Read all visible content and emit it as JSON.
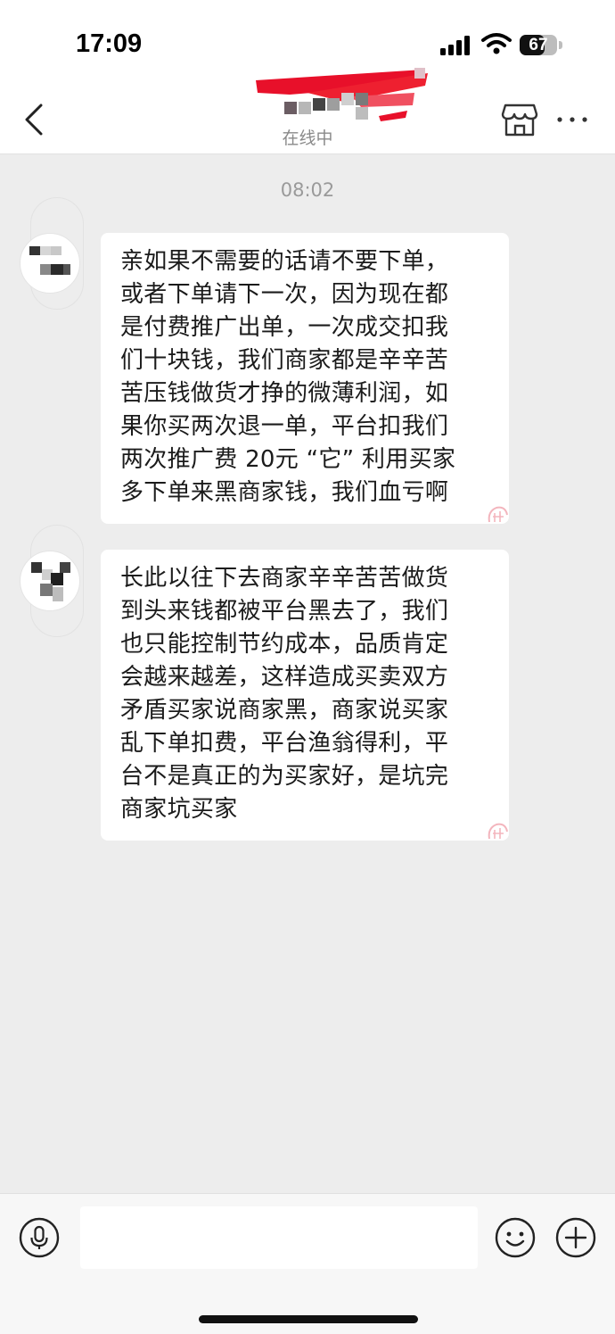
{
  "status_bar": {
    "time": "17:09",
    "battery_label": "67",
    "battery_level": 0.67
  },
  "nav": {
    "back_icon": "chevron-left-icon",
    "subtitle": "在线中",
    "shop_icon": "shop-icon",
    "more_icon": "more-dots-icon"
  },
  "chat": {
    "timestamp": "08:02",
    "messages": [
      {
        "lines": [
          "亲如果不需要的话请不要下单，",
          "或者下单请下一次，因为现在都",
          "是付费推广出单，一次成交扣我",
          "们十块钱，我们商家都是辛辛苦",
          "苦压钱做货才挣的微薄利润，如",
          "果你买两次退一单，平台扣我们",
          "两次推广费 20元 “它” 利用买家",
          "多下单来黑商家钱，我们血亏啊"
        ]
      },
      {
        "lines": [
          "长此以往下去商家辛辛苦苦做货",
          "到头来钱都被平台黑去了，我们",
          "也只能控制节约成本，品质肯定",
          "会越来越差，这样造成买卖双方",
          "矛盾买家说商家黑，商家说买家",
          "乱下单扣费，平台渔翁得利，平",
          "台不是真正的为买家好，是坑完",
          "商家坑买家"
        ]
      }
    ]
  },
  "input_bar": {
    "placeholder": "",
    "voice_icon": "microphone-icon",
    "emoji_icon": "smiley-icon",
    "plus_icon": "plus-circle-icon"
  },
  "colors": {
    "chat_background": "#ededed",
    "bubble": "#ffffff",
    "redaction": "#e8102a"
  }
}
